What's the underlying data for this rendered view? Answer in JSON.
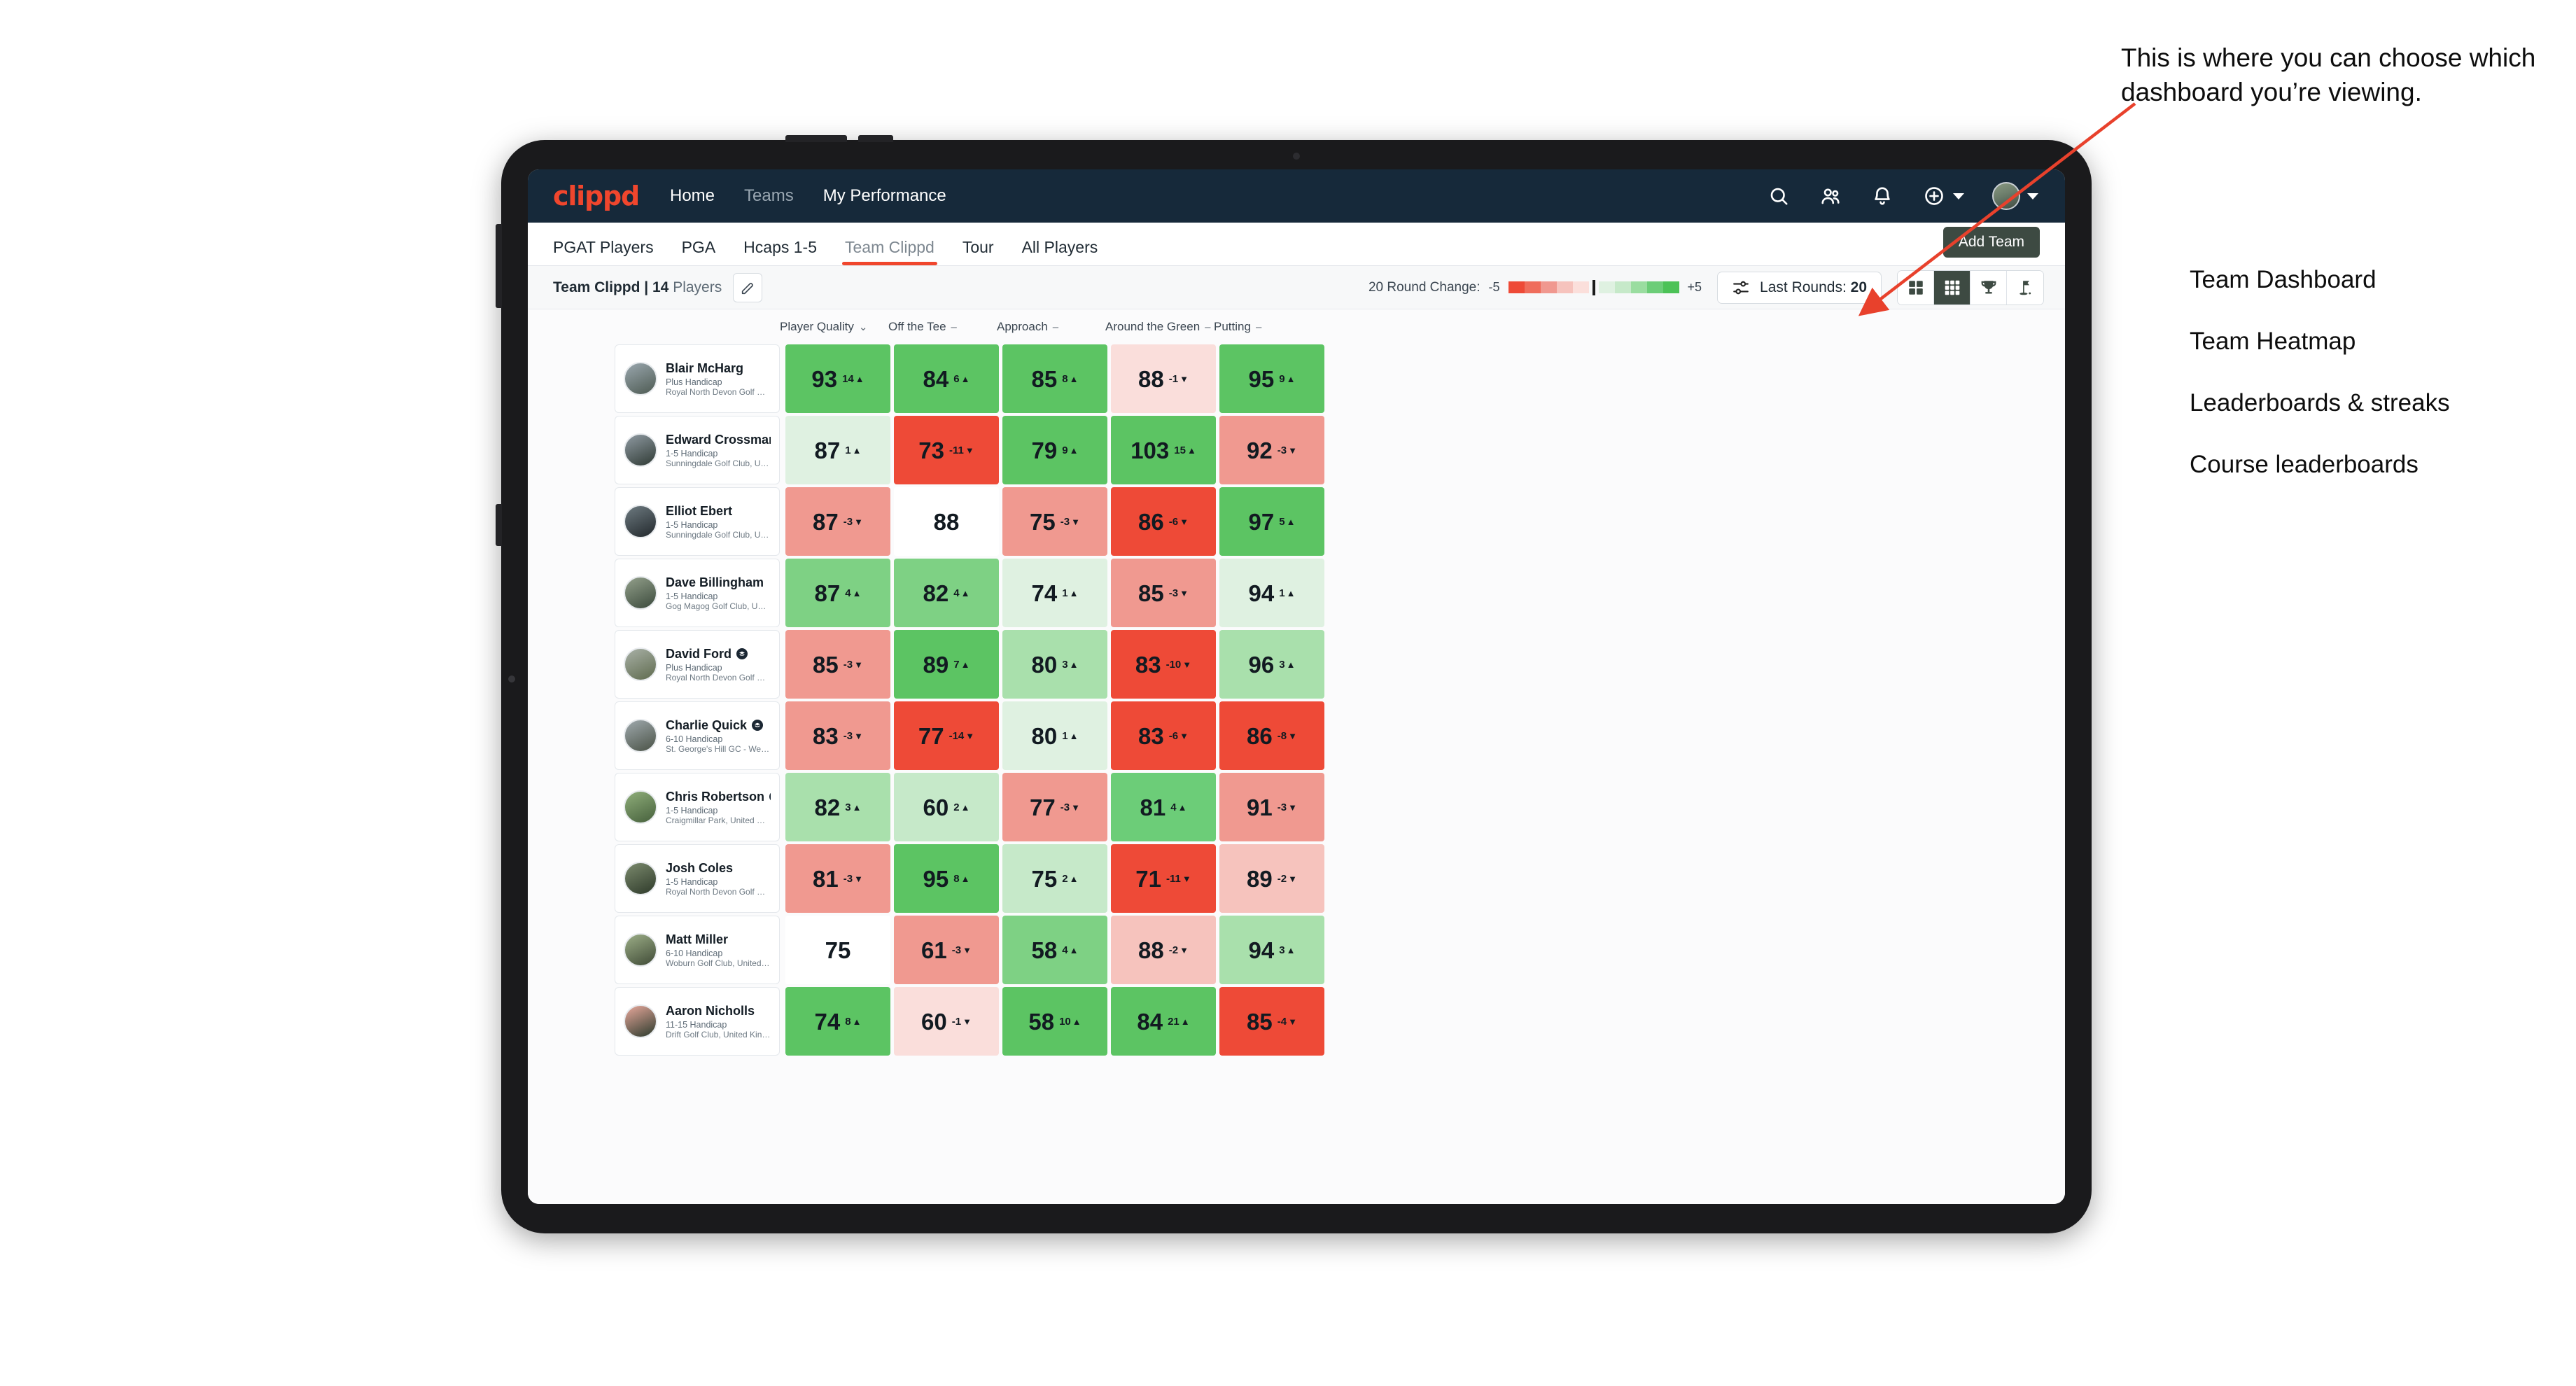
{
  "topnav": {
    "brand": "clippd",
    "links": [
      {
        "label": "Home",
        "dim": false
      },
      {
        "label": "Teams",
        "dim": true
      },
      {
        "label": "My Performance",
        "dim": false
      }
    ],
    "icons": [
      "search-icon",
      "people-icon",
      "bell-icon",
      "plus-circle-icon",
      "avatar"
    ],
    "bg_color": "#16293a",
    "brand_color": "#f0462d"
  },
  "tabs": {
    "items": [
      {
        "label": "PGAT Players",
        "active": false
      },
      {
        "label": "PGA",
        "active": false
      },
      {
        "label": "Hcaps 1-5",
        "active": false
      },
      {
        "label": "Team Clippd",
        "active": true
      },
      {
        "label": "Tour",
        "active": false
      },
      {
        "label": "All Players",
        "active": false
      }
    ],
    "add_team_label": "Add Team",
    "active_underline_color": "#f0462d"
  },
  "toolbar": {
    "team_name": "Team Clippd",
    "separator": " | ",
    "player_count": "14",
    "players_word": " Players",
    "edit_icon": "pencil-icon",
    "legend": {
      "label": "20 Round Change:",
      "min": "-5",
      "max": "+5",
      "swatches": [
        "#ee4a37",
        "#ef6d5c",
        "#f0988f",
        "#f6c3bd",
        "#fbdfdb",
        "#dff1e1",
        "#c6e9c9",
        "#9adda0",
        "#6ccd78",
        "#4cc257"
      ]
    },
    "last_rounds": {
      "label": "Last Rounds:",
      "value": "20",
      "icon": "sliders-icon"
    },
    "views": [
      {
        "name": "grid-2x2-icon",
        "active": false
      },
      {
        "name": "grid-3x3-icon",
        "active": true
      },
      {
        "name": "trophy-icon",
        "active": false
      },
      {
        "name": "golf-flag-icon",
        "active": false
      }
    ]
  },
  "table": {
    "columns": [
      {
        "label": "Player Quality",
        "control": "chevron-down-icon",
        "glyph": "⌄"
      },
      {
        "label": "Off the Tee",
        "control": "dash-icon",
        "glyph": "–"
      },
      {
        "label": "Approach",
        "control": "dash-icon",
        "glyph": "–"
      },
      {
        "label": "Around the Green",
        "control": "dash-icon",
        "glyph": "–"
      },
      {
        "label": "Putting",
        "control": "dash-icon",
        "glyph": "–"
      }
    ],
    "rows": [
      {
        "name": "Blair McHarg",
        "verified": false,
        "handicap": "Plus Handicap",
        "club": "Royal North Devon Golf Club, United Kingdom",
        "avatar_colors": [
          "#9aa7ae",
          "#4d5a52"
        ],
        "cells": [
          {
            "value": "93",
            "delta": "14",
            "dir": "up",
            "bg": "#5cc463"
          },
          {
            "value": "84",
            "delta": "6",
            "dir": "up",
            "bg": "#5cc463"
          },
          {
            "value": "85",
            "delta": "8",
            "dir": "up",
            "bg": "#5cc463"
          },
          {
            "value": "88",
            "delta": "-1",
            "dir": "down",
            "bg": "#fadedb"
          },
          {
            "value": "95",
            "delta": "9",
            "dir": "up",
            "bg": "#5cc463"
          }
        ]
      },
      {
        "name": "Edward Crossman",
        "verified": false,
        "handicap": "1-5 Handicap",
        "club": "Sunningdale Golf Club, United Kingdom",
        "avatar_colors": [
          "#8f9aa2",
          "#2f3a34"
        ],
        "cells": [
          {
            "value": "87",
            "delta": "1",
            "dir": "up",
            "bg": "#dff1e1"
          },
          {
            "value": "73",
            "delta": "-11",
            "dir": "down",
            "bg": "#ee4a37"
          },
          {
            "value": "79",
            "delta": "9",
            "dir": "up",
            "bg": "#5cc463"
          },
          {
            "value": "103",
            "delta": "15",
            "dir": "up",
            "bg": "#5cc463"
          },
          {
            "value": "92",
            "delta": "-3",
            "dir": "down",
            "bg": "#f09990"
          }
        ]
      },
      {
        "name": "Elliot Ebert",
        "verified": false,
        "handicap": "1-5 Handicap",
        "club": "Sunningdale Golf Club, United Kingdom",
        "avatar_colors": [
          "#6d7a80",
          "#22282c"
        ],
        "cells": [
          {
            "value": "87",
            "delta": "-3",
            "dir": "down",
            "bg": "#f09990"
          },
          {
            "value": "88",
            "delta": "",
            "dir": "",
            "bg": "#ffffff"
          },
          {
            "value": "75",
            "delta": "-3",
            "dir": "down",
            "bg": "#f09990"
          },
          {
            "value": "86",
            "delta": "-6",
            "dir": "down",
            "bg": "#ee4a37"
          },
          {
            "value": "97",
            "delta": "5",
            "dir": "up",
            "bg": "#5cc463"
          }
        ]
      },
      {
        "name": "Dave Billingham",
        "verified": false,
        "handicap": "1-5 Handicap",
        "club": "Gog Magog Golf Club, United Kingdom",
        "avatar_colors": [
          "#93a08b",
          "#3b4a3c"
        ],
        "cells": [
          {
            "value": "87",
            "delta": "4",
            "dir": "up",
            "bg": "#7ed184"
          },
          {
            "value": "82",
            "delta": "4",
            "dir": "up",
            "bg": "#7ed184"
          },
          {
            "value": "74",
            "delta": "1",
            "dir": "up",
            "bg": "#dff1e1"
          },
          {
            "value": "85",
            "delta": "-3",
            "dir": "down",
            "bg": "#f09990"
          },
          {
            "value": "94",
            "delta": "1",
            "dir": "up",
            "bg": "#dff1e1"
          }
        ]
      },
      {
        "name": "David Ford",
        "verified": true,
        "handicap": "Plus Handicap",
        "club": "Royal North Devon Golf Club, United Kingdom",
        "avatar_colors": [
          "#a8b0a6",
          "#5f6b4e"
        ],
        "cells": [
          {
            "value": "85",
            "delta": "-3",
            "dir": "down",
            "bg": "#f09990"
          },
          {
            "value": "89",
            "delta": "7",
            "dir": "up",
            "bg": "#5cc463"
          },
          {
            "value": "80",
            "delta": "3",
            "dir": "up",
            "bg": "#a9e0ac"
          },
          {
            "value": "83",
            "delta": "-10",
            "dir": "down",
            "bg": "#ee4a37"
          },
          {
            "value": "96",
            "delta": "3",
            "dir": "up",
            "bg": "#a9e0ac"
          }
        ]
      },
      {
        "name": "Charlie Quick",
        "verified": true,
        "handicap": "6-10 Handicap",
        "club": "St. George's Hill GC - Weybridge - Surrey, Uni...",
        "avatar_colors": [
          "#9fa9ad",
          "#4a5246"
        ],
        "cells": [
          {
            "value": "83",
            "delta": "-3",
            "dir": "down",
            "bg": "#f09990"
          },
          {
            "value": "77",
            "delta": "-14",
            "dir": "down",
            "bg": "#ee4a37"
          },
          {
            "value": "80",
            "delta": "1",
            "dir": "up",
            "bg": "#dff1e1"
          },
          {
            "value": "83",
            "delta": "-6",
            "dir": "down",
            "bg": "#ee4a37"
          },
          {
            "value": "86",
            "delta": "-8",
            "dir": "down",
            "bg": "#ee4a37"
          }
        ]
      },
      {
        "name": "Chris Robertson",
        "verified": true,
        "handicap": "1-5 Handicap",
        "club": "Craigmillar Park, United Kingdom",
        "avatar_colors": [
          "#8fae7a",
          "#46603c"
        ],
        "cells": [
          {
            "value": "82",
            "delta": "3",
            "dir": "up",
            "bg": "#a9e0ac"
          },
          {
            "value": "60",
            "delta": "2",
            "dir": "up",
            "bg": "#c6e9c9"
          },
          {
            "value": "77",
            "delta": "-3",
            "dir": "down",
            "bg": "#f09990"
          },
          {
            "value": "81",
            "delta": "4",
            "dir": "up",
            "bg": "#6ccd78"
          },
          {
            "value": "91",
            "delta": "-3",
            "dir": "down",
            "bg": "#f09990"
          }
        ]
      },
      {
        "name": "Josh Coles",
        "verified": false,
        "handicap": "1-5 Handicap",
        "club": "Royal North Devon Golf Club, United Kingdom",
        "avatar_colors": [
          "#7b8a6d",
          "#2e3a2a"
        ],
        "cells": [
          {
            "value": "81",
            "delta": "-3",
            "dir": "down",
            "bg": "#f09990"
          },
          {
            "value": "95",
            "delta": "8",
            "dir": "up",
            "bg": "#5cc463"
          },
          {
            "value": "75",
            "delta": "2",
            "dir": "up",
            "bg": "#c6e9c9"
          },
          {
            "value": "71",
            "delta": "-11",
            "dir": "down",
            "bg": "#ee4a37"
          },
          {
            "value": "89",
            "delta": "-2",
            "dir": "down",
            "bg": "#f6c3bd"
          }
        ]
      },
      {
        "name": "Matt Miller",
        "verified": false,
        "handicap": "6-10 Handicap",
        "club": "Woburn Golf Club, United Kingdom",
        "avatar_colors": [
          "#9cae87",
          "#3f4a36"
        ],
        "cells": [
          {
            "value": "75",
            "delta": "",
            "dir": "",
            "bg": "#ffffff"
          },
          {
            "value": "61",
            "delta": "-3",
            "dir": "down",
            "bg": "#f09990"
          },
          {
            "value": "58",
            "delta": "4",
            "dir": "up",
            "bg": "#7ed184"
          },
          {
            "value": "88",
            "delta": "-2",
            "dir": "down",
            "bg": "#f6c3bd"
          },
          {
            "value": "94",
            "delta": "3",
            "dir": "up",
            "bg": "#a9e0ac"
          }
        ]
      },
      {
        "name": "Aaron Nicholls",
        "verified": false,
        "handicap": "11-15 Handicap",
        "club": "Drift Golf Club, United Kingdom",
        "avatar_colors": [
          "#e8a89b",
          "#2b3a2c"
        ],
        "cells": [
          {
            "value": "74",
            "delta": "8",
            "dir": "up",
            "bg": "#5cc463"
          },
          {
            "value": "60",
            "delta": "-1",
            "dir": "down",
            "bg": "#fadedb"
          },
          {
            "value": "58",
            "delta": "10",
            "dir": "up",
            "bg": "#5cc463"
          },
          {
            "value": "84",
            "delta": "21",
            "dir": "up",
            "bg": "#5cc463"
          },
          {
            "value": "85",
            "delta": "-4",
            "dir": "down",
            "bg": "#ee4a37"
          }
        ]
      }
    ]
  },
  "annotation": {
    "callout": "This is where you can choose which dashboard you’re viewing.",
    "arrow_color": "#e8412c",
    "items": [
      "Team Dashboard",
      "Team Heatmap",
      "Leaderboards & streaks",
      "Course leaderboards"
    ]
  }
}
